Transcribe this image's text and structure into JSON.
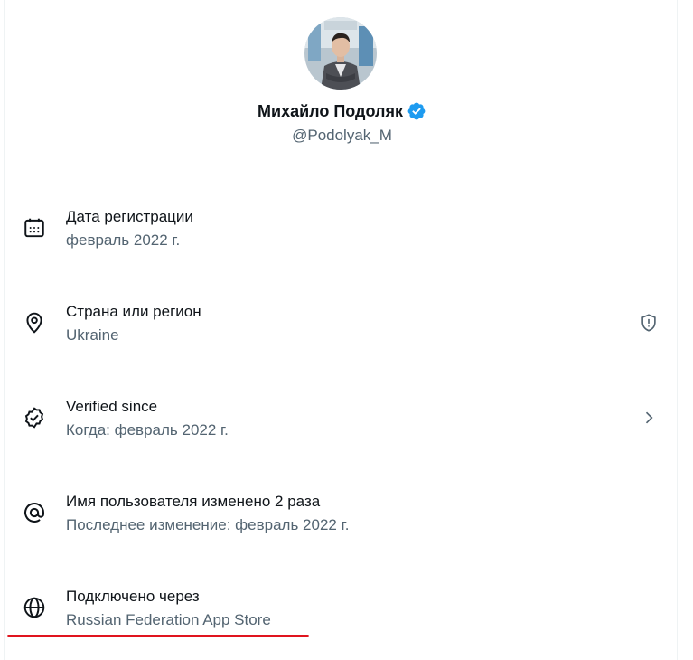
{
  "profile": {
    "display_name": "Михайло Подоляк",
    "handle": "@Podolyak_M",
    "verified_badge_color": "#1d9bf0"
  },
  "details": {
    "joined": {
      "title": "Дата регистрации",
      "value": "февраль 2022 г.",
      "icon": "calendar-icon"
    },
    "location": {
      "title": "Страна или регион",
      "value": "Ukraine",
      "icon": "location-pin-icon",
      "trailing_icon": "shield-alert-icon"
    },
    "verified": {
      "title": "Verified since",
      "value": "Когда: февраль 2022 г.",
      "icon": "verified-seal-icon",
      "trailing_icon": "chevron-right-icon"
    },
    "username": {
      "title": "Имя пользователя изменено 2 раза",
      "value": "Последнее изменение: февраль 2022 г.",
      "icon": "at-sign-icon"
    },
    "connected": {
      "title": "Подключено через",
      "value": "Russian Federation App Store",
      "icon": "globe-icon"
    }
  },
  "colors": {
    "primary_text": "#0f1419",
    "secondary_text": "#536471",
    "highlight_underline": "#e0141e"
  }
}
